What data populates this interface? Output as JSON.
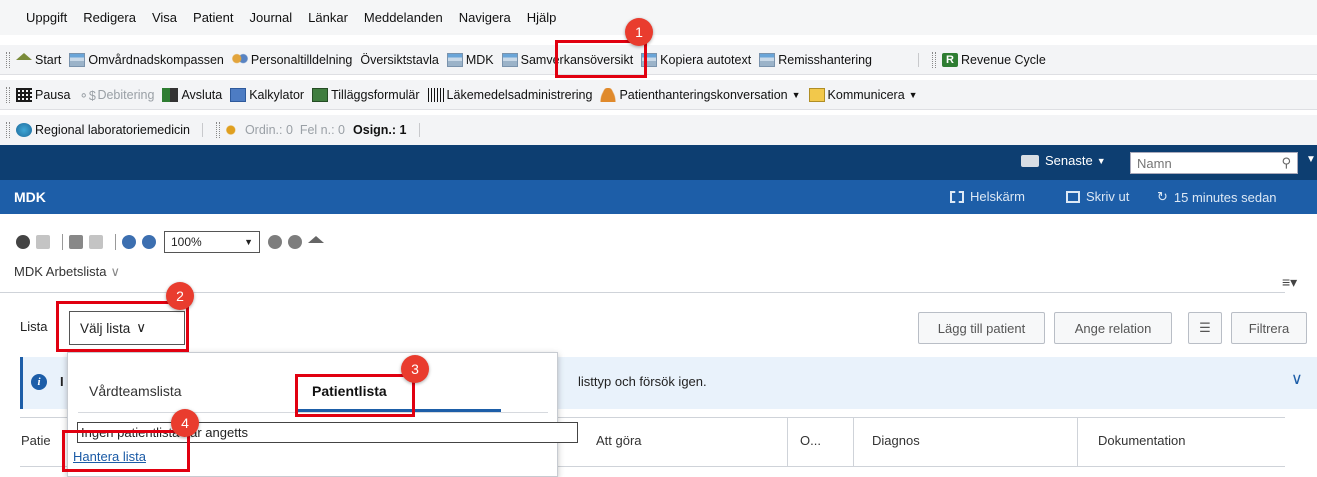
{
  "menubar": [
    "Uppgift",
    "Redigera",
    "Visa",
    "Patient",
    "Journal",
    "Länkar",
    "Meddelanden",
    "Navigera",
    "Hjälp"
  ],
  "toolbar1": {
    "start": "Start",
    "omvardnad": "Omvårdnadskompassen",
    "personal": "Personaltilldelning",
    "oversikt": "Översiktstavla",
    "mdk": "MDK",
    "samverkan": "Samverkansöversikt",
    "kopiera": "Kopiera autotext",
    "remiss": "Remisshantering",
    "revenue": "Revenue Cycle"
  },
  "toolbar2": {
    "pausa": "Pausa",
    "debitering": "Debitering",
    "avsluta": "Avsluta",
    "kalkylator": "Kalkylator",
    "tillagg": "Tilläggsformulär",
    "lakemedel": "Läkemedelsadministrering",
    "patientkonv": "Patienthanteringskonversation",
    "kommunicera": "Kommunicera"
  },
  "toolbar3": {
    "regional": "Regional laboratoriemedicin",
    "ordin": "Ordin.: 0",
    "feln": "Fel n.: 0",
    "osign": "Osign.: 1"
  },
  "navbar": {
    "recent": "Senaste",
    "search_placeholder": "Namn"
  },
  "actionbar": {
    "title": "MDK",
    "fullscreen": "Helskärm",
    "print": "Skriv ut",
    "refresh": "15 minutes sedan"
  },
  "zoom": "100%",
  "worklist": {
    "title": "MDK Arbetslista"
  },
  "lista": {
    "label": "Lista",
    "select": "Välj lista"
  },
  "buttons": {
    "add_patient": "Lägg till patient",
    "relation": "Ange relation",
    "filter": "Filtrera"
  },
  "info": {
    "letter": "I",
    "message": "listtyp och försök igen."
  },
  "columns": {
    "patient": "Patie",
    "todo": "Att göra",
    "o": "O...",
    "diagnos": "Diagnos",
    "dok": "Dokumentation"
  },
  "dropdown": {
    "tabs": [
      "Vårdteamslista",
      "Patientlista"
    ],
    "input_value": "Ingen patientlista har angetts",
    "manage_link": "Hantera lista"
  },
  "badges": [
    "1",
    "2",
    "3",
    "4"
  ],
  "colors": {
    "nav": "#0d3e71",
    "action": "#1d5ea8",
    "highlight": "#e10010",
    "badge": "#e93c2e"
  }
}
